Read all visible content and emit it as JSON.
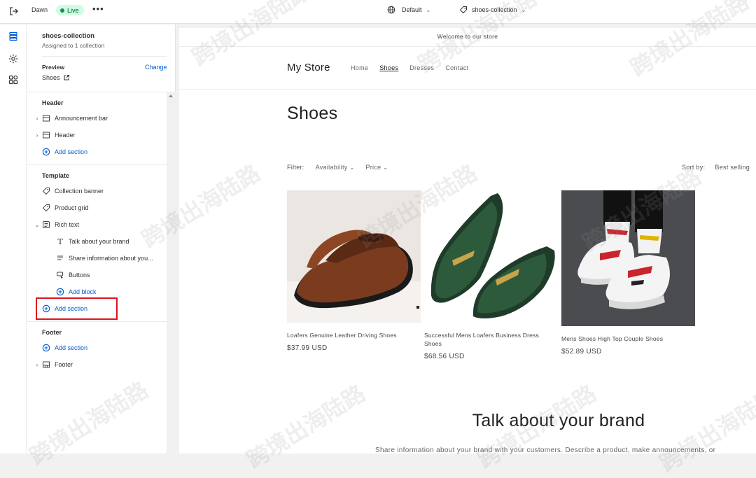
{
  "topbar": {
    "theme_name": "Dawn",
    "status": "Live",
    "more": "•••",
    "device_label": "Default",
    "template_label": "shoes-collection"
  },
  "panel": {
    "title": "shoes-collection",
    "subtitle": "Assigned to 1 collection",
    "preview_label": "Preview",
    "change_label": "Change",
    "preview_value": "Shoes",
    "header_group": {
      "label": "Header",
      "items": [
        "Announcement bar",
        "Header"
      ],
      "add_section": "Add section"
    },
    "template_group": {
      "label": "Template",
      "items": [
        "Collection banner",
        "Product grid",
        "Rich text"
      ],
      "rich_text_blocks": [
        "Talk about your brand",
        "Share information about you...",
        "Buttons"
      ],
      "add_block": "Add block",
      "add_section": "Add section"
    },
    "footer_group": {
      "label": "Footer",
      "add_section": "Add section",
      "items": [
        "Footer"
      ]
    }
  },
  "store": {
    "announcement": "Welcome to our store",
    "name": "My Store",
    "nav": [
      "Home",
      "Shoes",
      "Dresses",
      "Contact"
    ],
    "collection_title": "Shoes",
    "filter_label": "Filter:",
    "filter_options": [
      "Availability",
      "Price"
    ],
    "sort_label": "Sort by:",
    "sort_value": "Best selling",
    "products": [
      {
        "name": "Loafers Genuine Leather Driving Shoes",
        "price": "$37.99 USD"
      },
      {
        "name": "Successful Mens Loafers Business Dress Shoes",
        "price": "$68.56 USD"
      },
      {
        "name": "Mens Shoes High Top Couple Shoes",
        "price": "$52.89 USD"
      }
    ],
    "rich_text_heading": "Talk about your brand",
    "rich_text_body": "Share information about your brand with your customers. Describe a product, make announcements, or"
  },
  "watermark_text": "跨境出海陆路",
  "colors": {
    "accent": "#005bd3",
    "live_bg": "#cdfee1",
    "live_dot": "#29845a",
    "highlight": "#e0141e"
  }
}
